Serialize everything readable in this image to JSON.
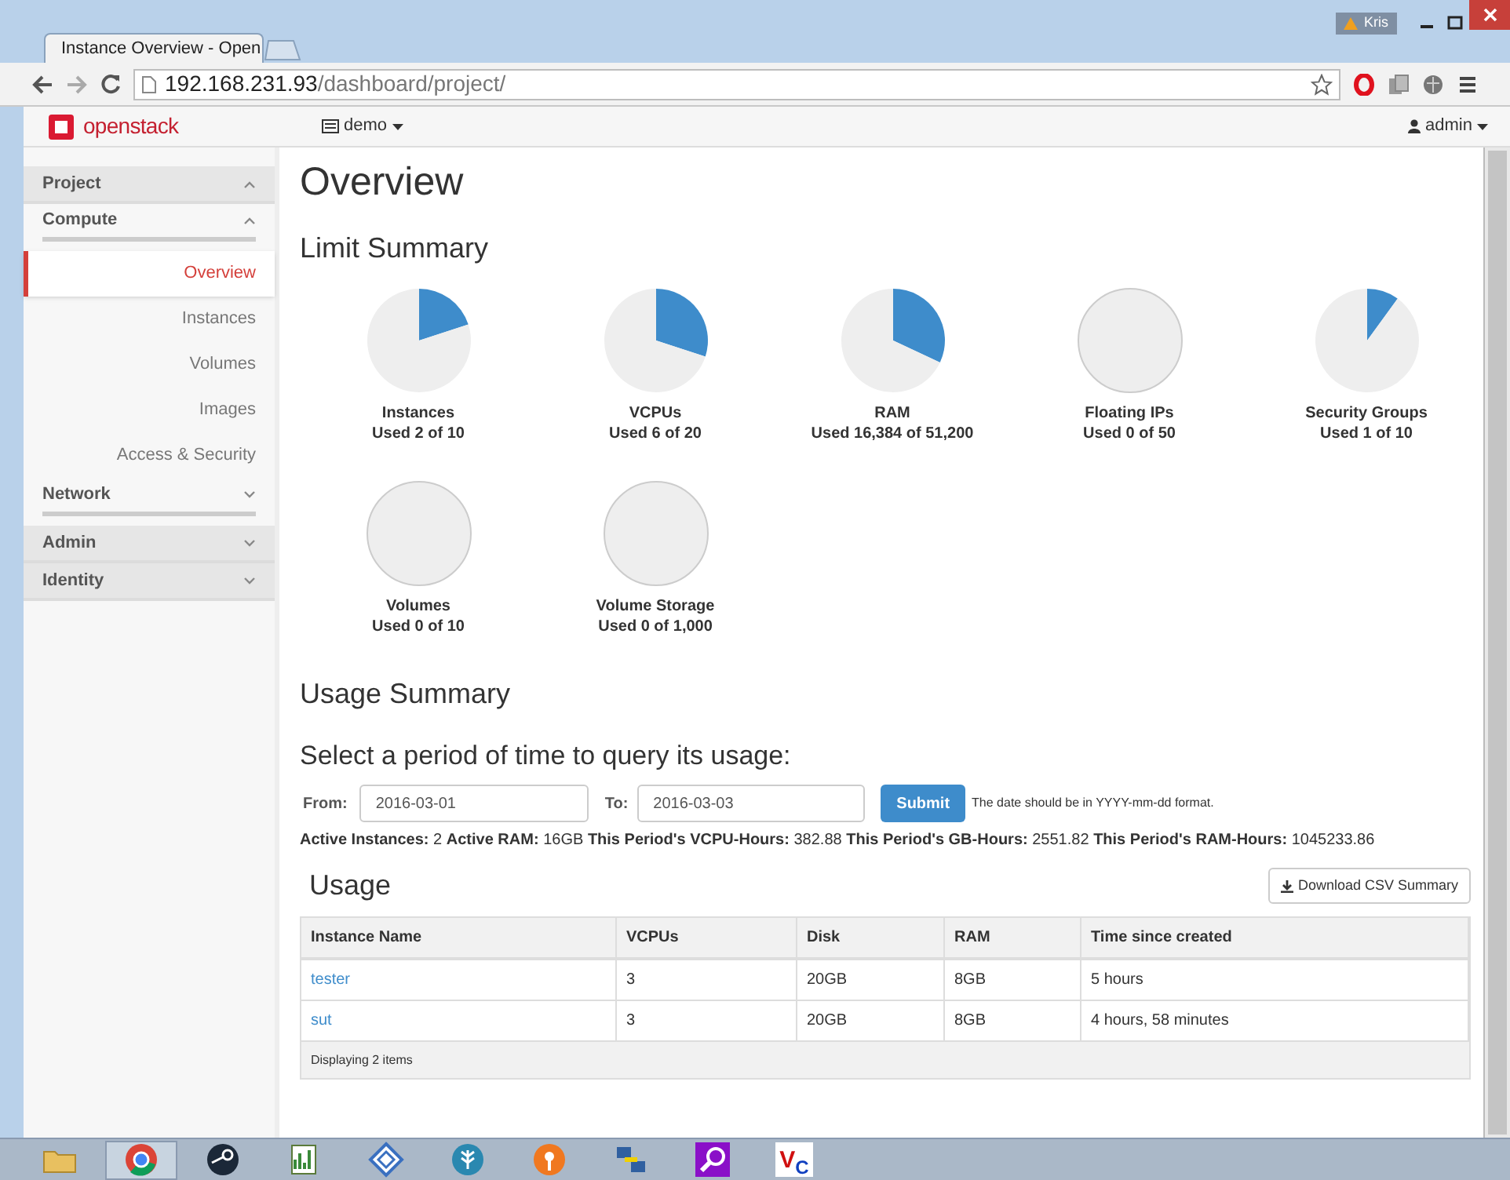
{
  "browser": {
    "tab_title": "Instance Overview - Open",
    "user_badge": "Kris",
    "url_host": "192.168.231.93",
    "url_path": "/dashboard/project/"
  },
  "header": {
    "logo": "openstack",
    "project_menu": "demo",
    "user_menu": "admin"
  },
  "sidebar": {
    "items": [
      {
        "label": "Project",
        "expanded": true,
        "children": [
          {
            "label": "Compute",
            "expanded": true,
            "children": [
              {
                "label": "Overview",
                "selected": true
              },
              {
                "label": "Instances",
                "selected": false
              },
              {
                "label": "Volumes",
                "selected": false
              },
              {
                "label": "Images",
                "selected": false
              },
              {
                "label": "Access & Security",
                "selected": false
              }
            ]
          },
          {
            "label": "Network",
            "expanded": false
          }
        ]
      },
      {
        "label": "Admin",
        "expanded": false
      },
      {
        "label": "Identity",
        "expanded": false
      }
    ]
  },
  "page_title": "Overview",
  "limit_summary": {
    "title": "Limit Summary",
    "quotas": [
      {
        "name": "Instances",
        "usage": "Used 2 of 10",
        "chart_data": {
          "type": "pie",
          "values": [
            20,
            80
          ]
        }
      },
      {
        "name": "VCPUs",
        "usage": "Used 6 of 20",
        "chart_data": {
          "type": "pie",
          "values": [
            30,
            70
          ]
        }
      },
      {
        "name": "RAM",
        "usage": "Used 16,384 of 51,200",
        "chart_data": {
          "type": "pie",
          "values": [
            32,
            68
          ]
        }
      },
      {
        "name": "Floating IPs",
        "usage": "Used 0 of 50",
        "chart_data": {
          "type": "pie",
          "values": [
            0,
            100
          ]
        }
      },
      {
        "name": "Security Groups",
        "usage": "Used 1 of 10",
        "chart_data": {
          "type": "pie",
          "values": [
            10,
            90
          ]
        }
      },
      {
        "name": "Volumes",
        "usage": "Used 0 of 10",
        "chart_data": {
          "type": "pie",
          "values": [
            0,
            100
          ]
        }
      },
      {
        "name": "Volume Storage",
        "usage": "Used 0 of 1,000",
        "chart_data": {
          "type": "pie",
          "values": [
            0,
            100
          ]
        }
      }
    ]
  },
  "usage_summary": {
    "title": "Usage Summary",
    "subtitle": "Select a period of time to query its usage:",
    "from_label": "From:",
    "from_value": "2016-03-01",
    "to_label": "To:",
    "to_value": "2016-03-03",
    "submit": "Submit",
    "hint": "The date should be in YYYY-mm-dd format.",
    "stats": "**Active Instances:** 2 **Active RAM:** 16GB **This Period's VCPU-Hours:** 382.88 **This Period's GB-Hours:** 2551.82 **This Period's RAM-Hours:** 1045233.86"
  },
  "usage": {
    "title": "Usage",
    "download": "Download CSV Summary",
    "columns": [
      "Instance Name",
      "VCPUs",
      "Disk",
      "RAM",
      "Time since created"
    ],
    "rows": [
      [
        "tester",
        "3",
        "20GB",
        "8GB",
        "5 hours"
      ],
      [
        "sut",
        "3",
        "20GB",
        "8GB",
        "4 hours, 58 minutes"
      ]
    ],
    "footer": "Displaying 2 items"
  },
  "taskbar": {
    "items": [
      {
        "kind": "folder",
        "active": false
      },
      {
        "kind": "chrome",
        "active": true
      },
      {
        "kind": "steam",
        "active": false
      },
      {
        "kind": "notepad",
        "active": false
      },
      {
        "kind": "diamond",
        "active": false
      },
      {
        "kind": "tree",
        "active": false
      },
      {
        "kind": "keyhole",
        "active": false
      },
      {
        "kind": "network",
        "active": false
      },
      {
        "kind": "search",
        "active": false
      },
      {
        "kind": "vnc",
        "active": false,
        "letters": [
          "V",
          "C"
        ]
      }
    ]
  }
}
